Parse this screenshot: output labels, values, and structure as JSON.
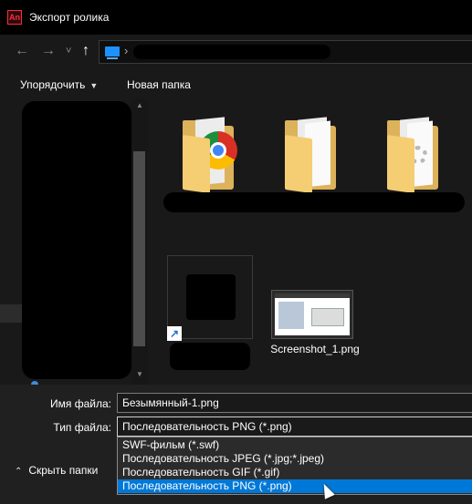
{
  "window": {
    "title": "Экспорт ролика",
    "app_icon": "An"
  },
  "nav": {
    "back_icon": "←",
    "forward_icon": "→",
    "recent_icon": "˅",
    "up_icon": "↑",
    "chevron": "›"
  },
  "toolbar": {
    "organize_label": "Упорядочить",
    "new_folder_label": "Новая папка"
  },
  "files": [
    {
      "type": "folder",
      "variant": "chrome"
    },
    {
      "type": "folder",
      "variant": "documents"
    },
    {
      "type": "folder",
      "variant": "settings"
    },
    {
      "type": "shortcut"
    },
    {
      "type": "image",
      "name": "Screenshot_1.png"
    }
  ],
  "form": {
    "filename_label": "Имя файла:",
    "filename_value": "Безымянный-1.png",
    "filetype_label": "Тип файла:",
    "filetype_value": "Последовательность PNG (*.png)",
    "filetype_options": [
      "SWF-фильм (*.swf)",
      "Последовательность JPEG (*.jpg;*.jpeg)",
      "Последовательность GIF (*.gif)",
      "Последовательность PNG (*.png)"
    ],
    "selected_index": 3
  },
  "footer": {
    "hide_folders_label": "Скрыть папки"
  },
  "colors": {
    "background": "#191919",
    "selection": "#0078d7",
    "folder": "#dcb25a"
  }
}
